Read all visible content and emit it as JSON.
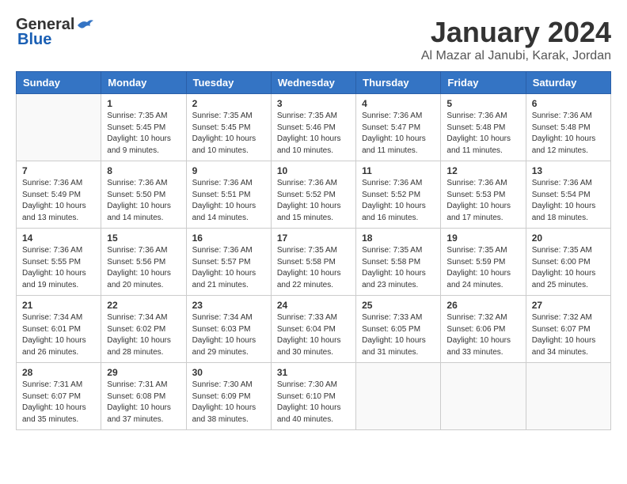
{
  "header": {
    "logo": {
      "general": "General",
      "blue": "Blue"
    },
    "title": "January 2024",
    "location": "Al Mazar al Janubi, Karak, Jordan"
  },
  "weekdays": [
    "Sunday",
    "Monday",
    "Tuesday",
    "Wednesday",
    "Thursday",
    "Friday",
    "Saturday"
  ],
  "weeks": [
    [
      {
        "day": "",
        "sunrise": "",
        "sunset": "",
        "daylight": ""
      },
      {
        "day": "1",
        "sunrise": "Sunrise: 7:35 AM",
        "sunset": "Sunset: 5:45 PM",
        "daylight": "Daylight: 10 hours and 9 minutes."
      },
      {
        "day": "2",
        "sunrise": "Sunrise: 7:35 AM",
        "sunset": "Sunset: 5:45 PM",
        "daylight": "Daylight: 10 hours and 10 minutes."
      },
      {
        "day": "3",
        "sunrise": "Sunrise: 7:35 AM",
        "sunset": "Sunset: 5:46 PM",
        "daylight": "Daylight: 10 hours and 10 minutes."
      },
      {
        "day": "4",
        "sunrise": "Sunrise: 7:36 AM",
        "sunset": "Sunset: 5:47 PM",
        "daylight": "Daylight: 10 hours and 11 minutes."
      },
      {
        "day": "5",
        "sunrise": "Sunrise: 7:36 AM",
        "sunset": "Sunset: 5:48 PM",
        "daylight": "Daylight: 10 hours and 11 minutes."
      },
      {
        "day": "6",
        "sunrise": "Sunrise: 7:36 AM",
        "sunset": "Sunset: 5:48 PM",
        "daylight": "Daylight: 10 hours and 12 minutes."
      }
    ],
    [
      {
        "day": "7",
        "sunrise": "Sunrise: 7:36 AM",
        "sunset": "Sunset: 5:49 PM",
        "daylight": "Daylight: 10 hours and 13 minutes."
      },
      {
        "day": "8",
        "sunrise": "Sunrise: 7:36 AM",
        "sunset": "Sunset: 5:50 PM",
        "daylight": "Daylight: 10 hours and 14 minutes."
      },
      {
        "day": "9",
        "sunrise": "Sunrise: 7:36 AM",
        "sunset": "Sunset: 5:51 PM",
        "daylight": "Daylight: 10 hours and 14 minutes."
      },
      {
        "day": "10",
        "sunrise": "Sunrise: 7:36 AM",
        "sunset": "Sunset: 5:52 PM",
        "daylight": "Daylight: 10 hours and 15 minutes."
      },
      {
        "day": "11",
        "sunrise": "Sunrise: 7:36 AM",
        "sunset": "Sunset: 5:52 PM",
        "daylight": "Daylight: 10 hours and 16 minutes."
      },
      {
        "day": "12",
        "sunrise": "Sunrise: 7:36 AM",
        "sunset": "Sunset: 5:53 PM",
        "daylight": "Daylight: 10 hours and 17 minutes."
      },
      {
        "day": "13",
        "sunrise": "Sunrise: 7:36 AM",
        "sunset": "Sunset: 5:54 PM",
        "daylight": "Daylight: 10 hours and 18 minutes."
      }
    ],
    [
      {
        "day": "14",
        "sunrise": "Sunrise: 7:36 AM",
        "sunset": "Sunset: 5:55 PM",
        "daylight": "Daylight: 10 hours and 19 minutes."
      },
      {
        "day": "15",
        "sunrise": "Sunrise: 7:36 AM",
        "sunset": "Sunset: 5:56 PM",
        "daylight": "Daylight: 10 hours and 20 minutes."
      },
      {
        "day": "16",
        "sunrise": "Sunrise: 7:36 AM",
        "sunset": "Sunset: 5:57 PM",
        "daylight": "Daylight: 10 hours and 21 minutes."
      },
      {
        "day": "17",
        "sunrise": "Sunrise: 7:35 AM",
        "sunset": "Sunset: 5:58 PM",
        "daylight": "Daylight: 10 hours and 22 minutes."
      },
      {
        "day": "18",
        "sunrise": "Sunrise: 7:35 AM",
        "sunset": "Sunset: 5:58 PM",
        "daylight": "Daylight: 10 hours and 23 minutes."
      },
      {
        "day": "19",
        "sunrise": "Sunrise: 7:35 AM",
        "sunset": "Sunset: 5:59 PM",
        "daylight": "Daylight: 10 hours and 24 minutes."
      },
      {
        "day": "20",
        "sunrise": "Sunrise: 7:35 AM",
        "sunset": "Sunset: 6:00 PM",
        "daylight": "Daylight: 10 hours and 25 minutes."
      }
    ],
    [
      {
        "day": "21",
        "sunrise": "Sunrise: 7:34 AM",
        "sunset": "Sunset: 6:01 PM",
        "daylight": "Daylight: 10 hours and 26 minutes."
      },
      {
        "day": "22",
        "sunrise": "Sunrise: 7:34 AM",
        "sunset": "Sunset: 6:02 PM",
        "daylight": "Daylight: 10 hours and 28 minutes."
      },
      {
        "day": "23",
        "sunrise": "Sunrise: 7:34 AM",
        "sunset": "Sunset: 6:03 PM",
        "daylight": "Daylight: 10 hours and 29 minutes."
      },
      {
        "day": "24",
        "sunrise": "Sunrise: 7:33 AM",
        "sunset": "Sunset: 6:04 PM",
        "daylight": "Daylight: 10 hours and 30 minutes."
      },
      {
        "day": "25",
        "sunrise": "Sunrise: 7:33 AM",
        "sunset": "Sunset: 6:05 PM",
        "daylight": "Daylight: 10 hours and 31 minutes."
      },
      {
        "day": "26",
        "sunrise": "Sunrise: 7:32 AM",
        "sunset": "Sunset: 6:06 PM",
        "daylight": "Daylight: 10 hours and 33 minutes."
      },
      {
        "day": "27",
        "sunrise": "Sunrise: 7:32 AM",
        "sunset": "Sunset: 6:07 PM",
        "daylight": "Daylight: 10 hours and 34 minutes."
      }
    ],
    [
      {
        "day": "28",
        "sunrise": "Sunrise: 7:31 AM",
        "sunset": "Sunset: 6:07 PM",
        "daylight": "Daylight: 10 hours and 35 minutes."
      },
      {
        "day": "29",
        "sunrise": "Sunrise: 7:31 AM",
        "sunset": "Sunset: 6:08 PM",
        "daylight": "Daylight: 10 hours and 37 minutes."
      },
      {
        "day": "30",
        "sunrise": "Sunrise: 7:30 AM",
        "sunset": "Sunset: 6:09 PM",
        "daylight": "Daylight: 10 hours and 38 minutes."
      },
      {
        "day": "31",
        "sunrise": "Sunrise: 7:30 AM",
        "sunset": "Sunset: 6:10 PM",
        "daylight": "Daylight: 10 hours and 40 minutes."
      },
      {
        "day": "",
        "sunrise": "",
        "sunset": "",
        "daylight": ""
      },
      {
        "day": "",
        "sunrise": "",
        "sunset": "",
        "daylight": ""
      },
      {
        "day": "",
        "sunrise": "",
        "sunset": "",
        "daylight": ""
      }
    ]
  ]
}
